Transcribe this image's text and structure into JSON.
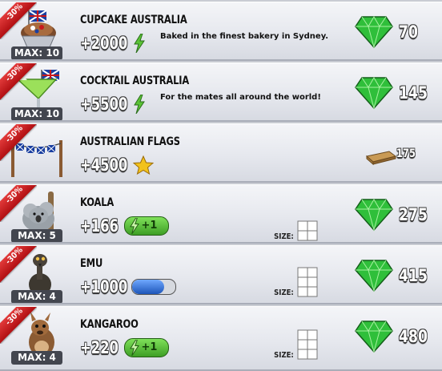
{
  "items": [
    {
      "discount": "-30%",
      "max": "MAX: 10",
      "name": "CUPCAKE AUSTRALIA",
      "reward": "+2000",
      "reward_type": "energy-bolt",
      "description": "Baked in the finest bakery in Sydney.",
      "price": "70",
      "currency": "gem",
      "thumb": "cupcake-icon"
    },
    {
      "discount": "-30%",
      "max": "MAX: 10",
      "name": "COCKTAIL AUSTRALIA",
      "reward": "+5500",
      "reward_type": "energy-bolt",
      "description": "For the mates all around the world!",
      "price": "145",
      "currency": "gem",
      "thumb": "cocktail-icon"
    },
    {
      "discount": "-30%",
      "name": "AUSTRALIAN FLAGS",
      "reward": "+4500",
      "reward_type": "star",
      "price": "175",
      "currency": "wood-plank",
      "thumb": "bunting-flags-icon"
    },
    {
      "discount": "-30%",
      "max": "MAX: 5",
      "name": "KOALA",
      "reward": "+166",
      "reward_type": "energy-plus",
      "energy_plus": "+1",
      "size_label": "SIZE:",
      "price": "275",
      "currency": "gem",
      "thumb": "koala-icon"
    },
    {
      "discount": "-30%",
      "max": "MAX: 4",
      "name": "EMU",
      "reward": "+1000",
      "reward_type": "blue-bar",
      "size_label": "SIZE:",
      "price": "415",
      "currency": "gem",
      "thumb": "emu-icon"
    },
    {
      "discount": "-30%",
      "max": "MAX: 4",
      "name": "KANGAROO",
      "reward": "+220",
      "reward_type": "energy-plus",
      "energy_plus": "+1",
      "size_label": "SIZE:",
      "price": "480",
      "currency": "gem",
      "thumb": "kangaroo-icon"
    }
  ],
  "colors": {
    "gem": "#2fbf3a",
    "ribbon": "#c8181b",
    "energy": "#5bc236",
    "star": "#f2c21b",
    "blue_bar": "#2f74d8"
  }
}
